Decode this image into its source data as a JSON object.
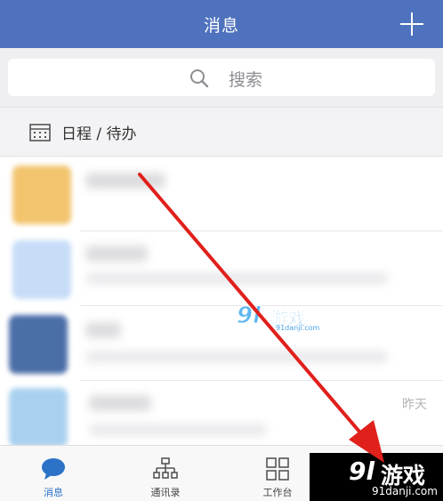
{
  "header": {
    "title": "消息",
    "add_icon": "plus-icon"
  },
  "search": {
    "placeholder": "搜索",
    "icon": "search-icon"
  },
  "schedule": {
    "label": "日程 / 待办",
    "icon": "calendar-icon"
  },
  "conversations": [
    {
      "avatar_color": "#f2c46e",
      "time": ""
    },
    {
      "avatar_color": "#c6dcf7",
      "time": ""
    },
    {
      "avatar_color": "#4a6ea8",
      "time": ""
    },
    {
      "avatar_color": "#a9d1ef",
      "time": "昨天"
    }
  ],
  "watermark": {
    "brand": "9l游戏",
    "big": "9l",
    "text": "游戏",
    "url": "91danji.com"
  },
  "tabbar": {
    "tabs": [
      {
        "label": "消息",
        "icon": "chat-bubble-icon",
        "active": true
      },
      {
        "label": "通讯录",
        "icon": "org-chart-icon",
        "active": false
      },
      {
        "label": "工作台",
        "icon": "grid-icon",
        "active": false
      }
    ]
  },
  "colors": {
    "header_bg": "#4e72bd",
    "accent": "#2c72c7",
    "arrow": "#e0201b"
  }
}
